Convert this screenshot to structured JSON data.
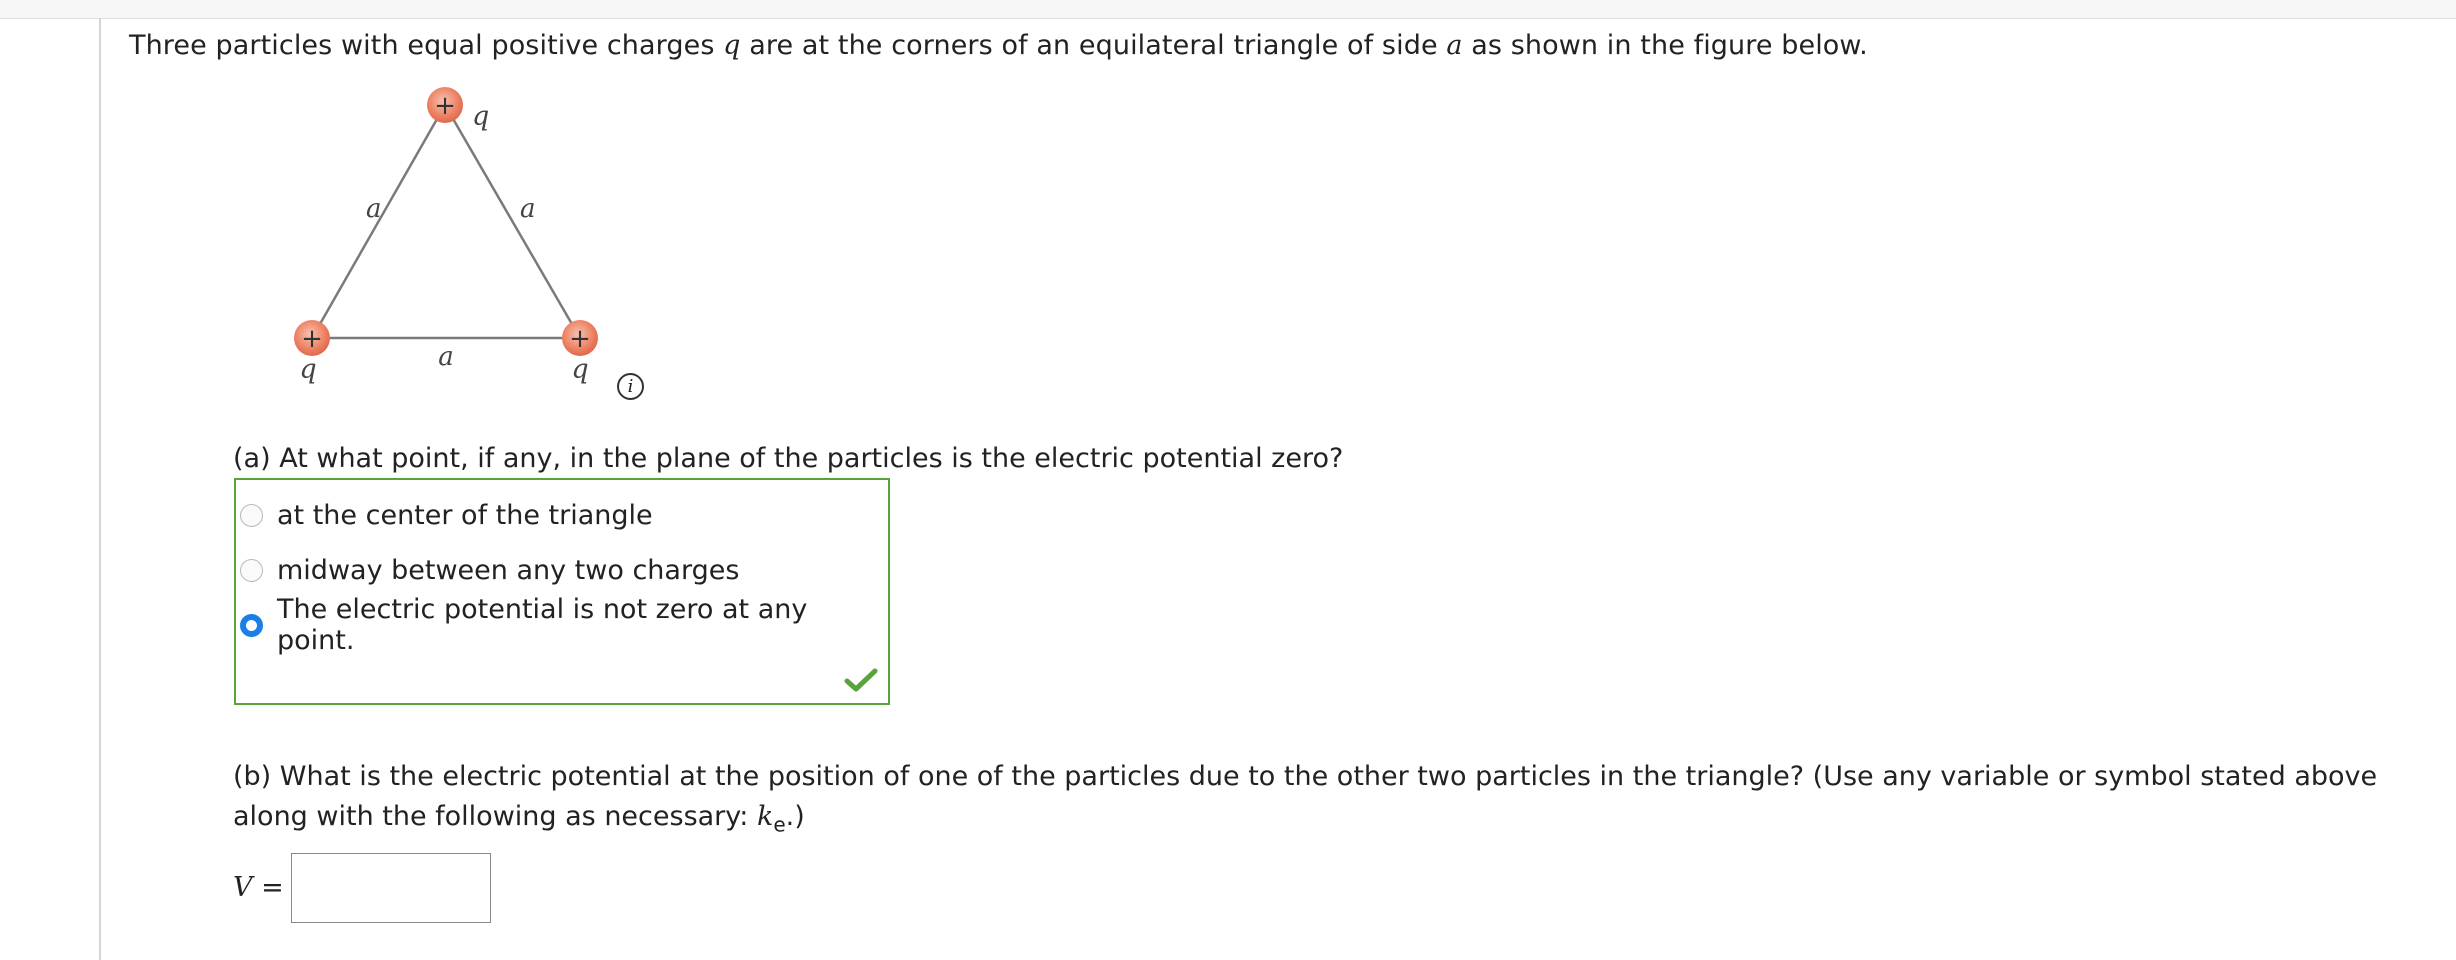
{
  "intro": {
    "text_before_q": "Three particles with equal positive charges ",
    "var_q": "q",
    "text_middle": " are at the corners of an equilateral triangle of side ",
    "var_a": "a",
    "text_after": " as shown in the figure below."
  },
  "figure": {
    "side_label": "a",
    "charge_label": "q",
    "charge_sign": "+",
    "info_icon": "i"
  },
  "question_a": {
    "prompt": "(a) At what point, if any, in the plane of the particles is the electric potential zero?",
    "options": [
      "at the center of the triangle",
      "midway between any two charges",
      "The electric potential is not zero at any point."
    ],
    "selected_index": 2,
    "status_icon": "check-icon",
    "status_color": "#5aa33a"
  },
  "question_b": {
    "prompt_text": "(b) What is the electric potential at the position of one of the particles due to the other two particles in the triangle? (Use any variable or symbol stated above along with the following as necessary: ",
    "symbol": "k",
    "symbol_sub": "e",
    "prompt_end": ".)"
  },
  "answer_field": {
    "variable": "V",
    "equals": " =",
    "value": ""
  }
}
